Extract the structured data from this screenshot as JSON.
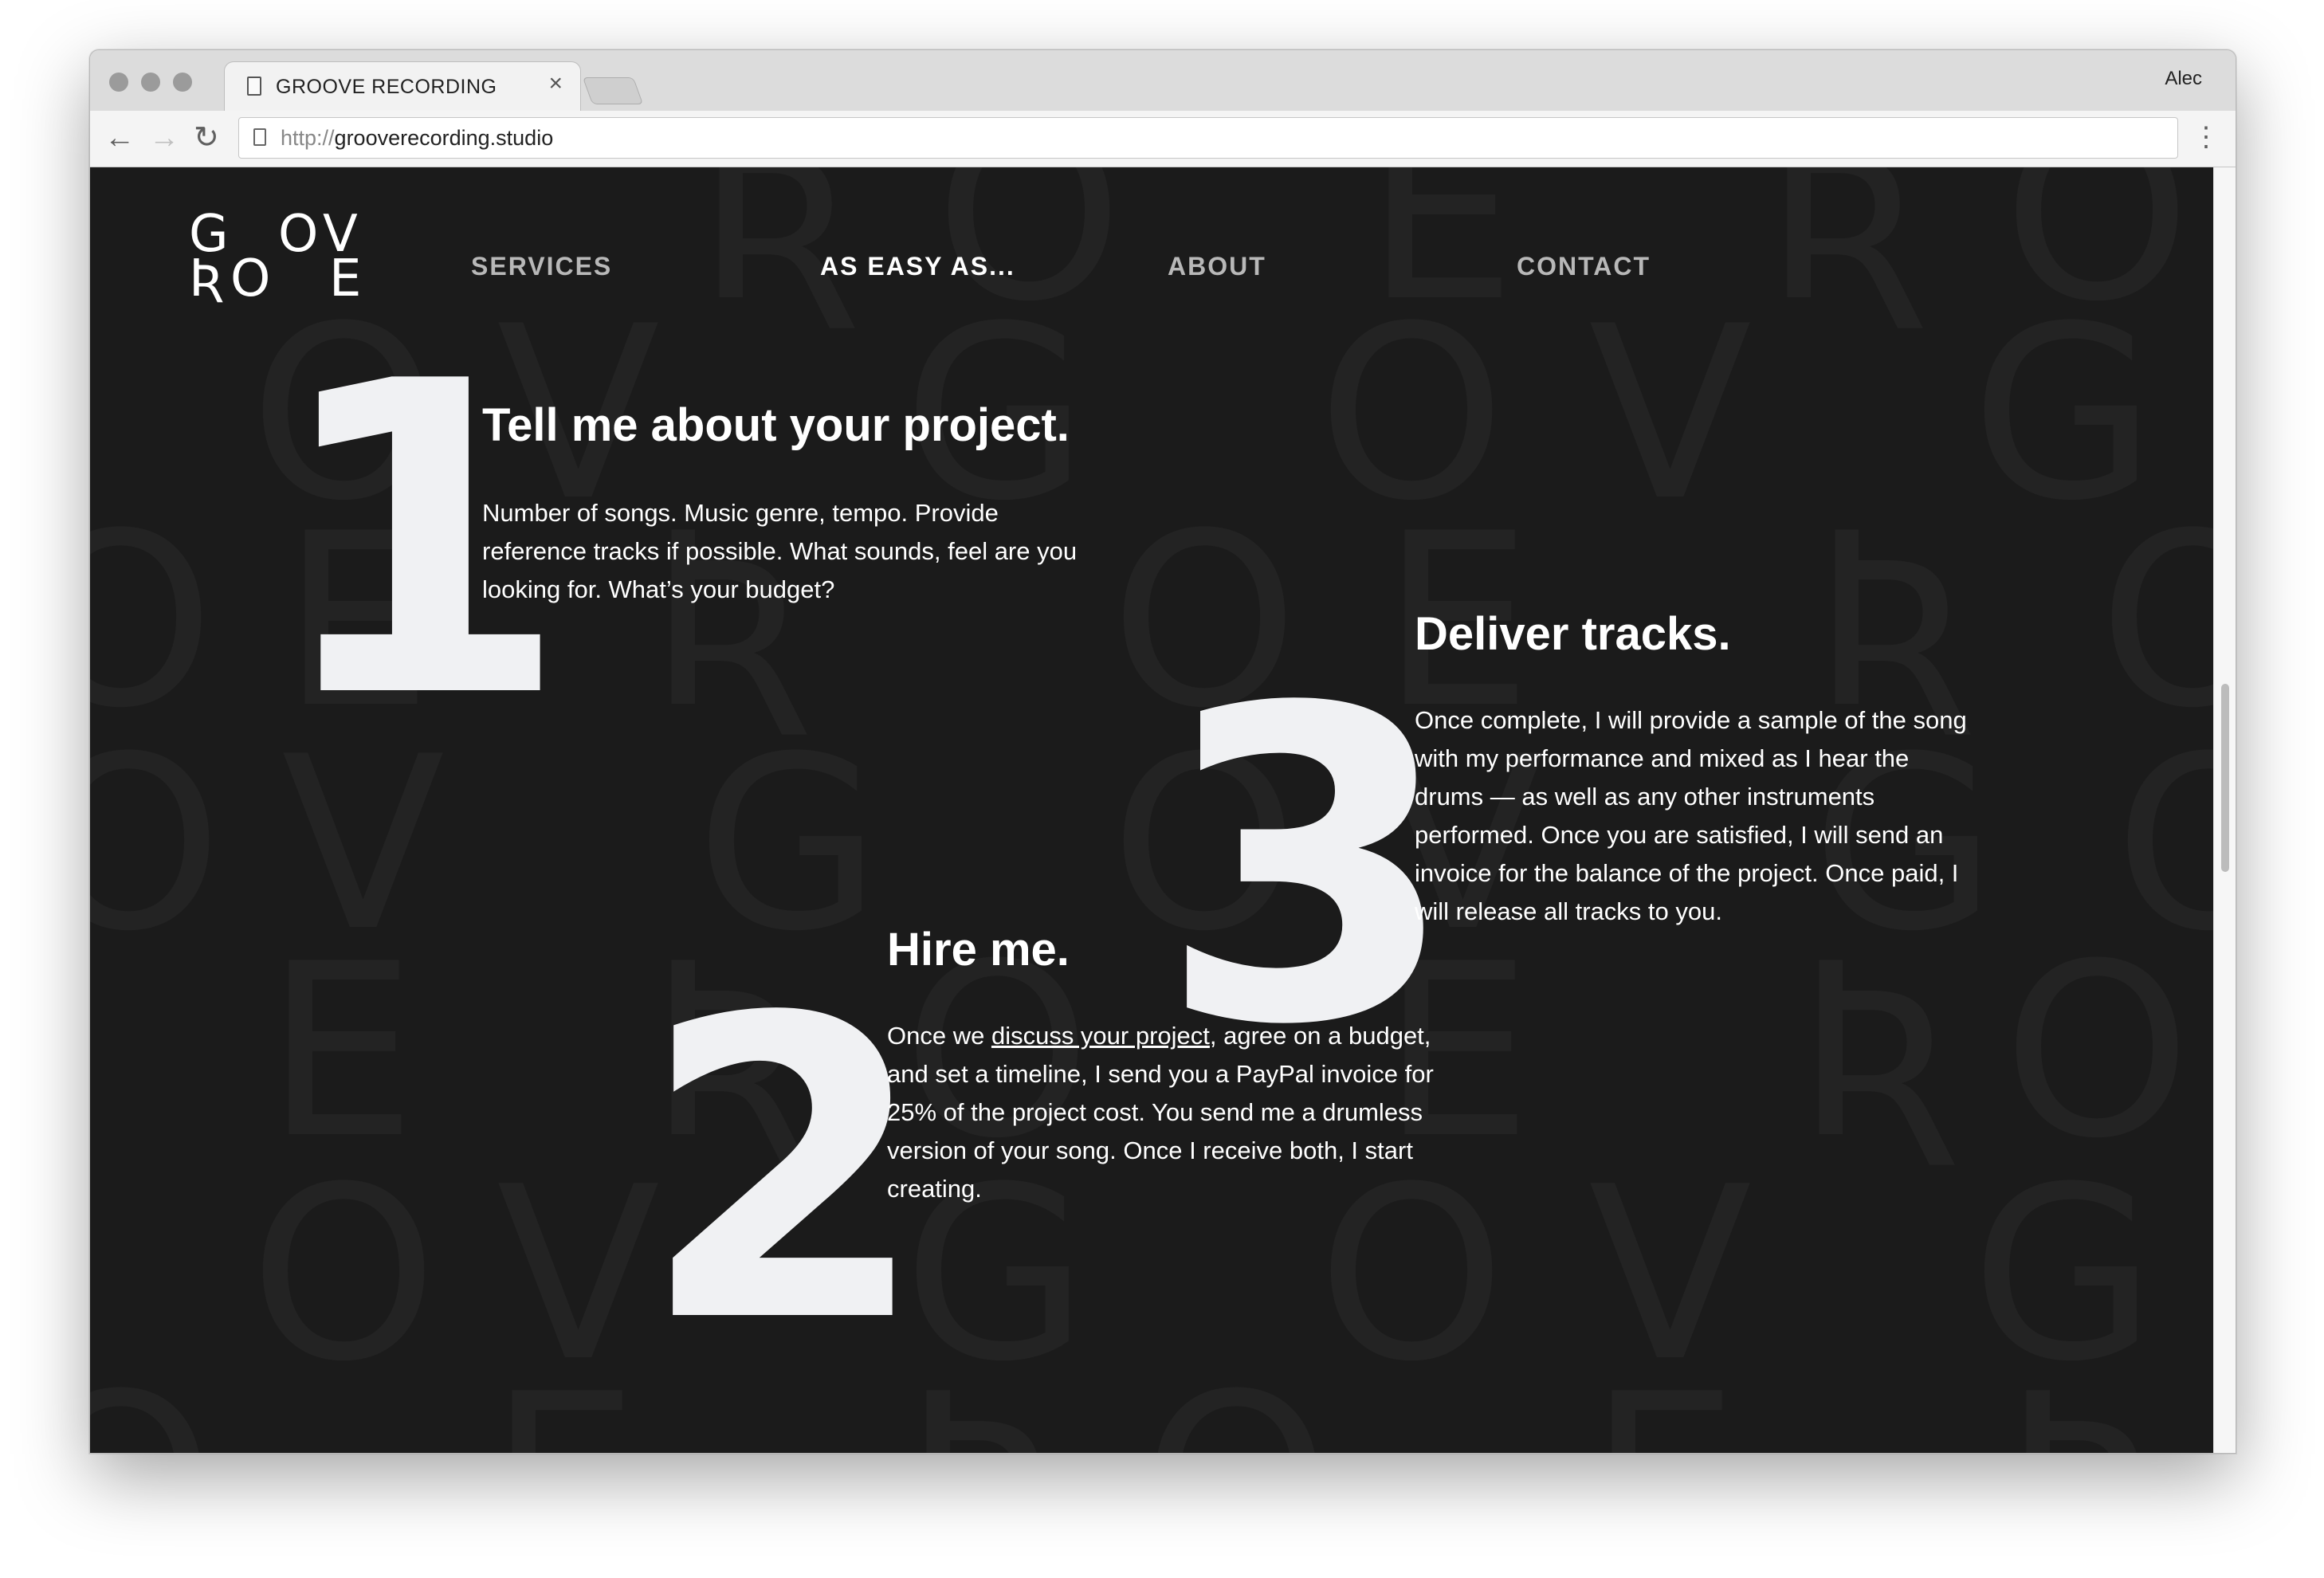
{
  "browser": {
    "tab_title": "GROOVE RECORDING",
    "tab_close": "×",
    "profile": "Alec",
    "url_scheme": "http://",
    "url_host": "grooverecording.studio",
    "back": "←",
    "forward": "→",
    "reload": "↻",
    "menu": "⋮"
  },
  "logo": {
    "letters": [
      "G",
      "O",
      "V",
      "Ʀ",
      "O",
      "E"
    ]
  },
  "nav": {
    "items": [
      {
        "label": "SERVICES"
      },
      {
        "label": "AS EASY AS..."
      },
      {
        "label": "ABOUT"
      },
      {
        "label": "CONTACT"
      }
    ],
    "active_index": 1
  },
  "steps": [
    {
      "number": "1",
      "title": "Tell me about your project.",
      "lines": [
        "Number of songs. Music genre, tempo. Provide",
        "reference tracks if possible. What sounds, feel are you",
        "looking for. What’s your budget?"
      ]
    },
    {
      "number": "2",
      "title": "Hire me.",
      "line1_before": "Once we ",
      "line1_link": "discuss your project",
      "line1_after": ", agree on a budget,",
      "lines": [
        "and set a timeline, I send you a PayPal invoice for",
        "25% of the project cost. You send me a drumless",
        "version of your song. Once I receive both, I start",
        "creating."
      ]
    },
    {
      "number": "3",
      "title": "Deliver tracks.",
      "lines": [
        "Once complete, I will provide a sample of the song",
        "with my performance and mixed as I hear the",
        "drums — as well as any other instruments",
        "performed. Once you are satisfied, I will send an",
        "invoice for the balance of the project. Once paid, I",
        "will release all tracks to you."
      ]
    }
  ],
  "colors": {
    "page_background": "#1b1b1b",
    "pattern_letters": "#232323",
    "text": "#ffffff",
    "nav_inactive": "#b8b8b8",
    "big_numbers": "#f0f1f3"
  }
}
